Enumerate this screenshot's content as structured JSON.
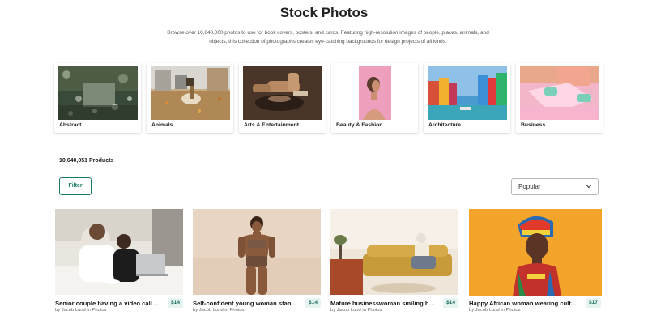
{
  "header": {
    "title": "Stock Photos",
    "description": "Browse over 10,640,000 photos to use for book covers, posters, and cards. Featuring high-resolution images of people, places, animals, and objects, this collection of photographs creates eye-catching backgrounds for design projects of all kinds."
  },
  "categories": [
    {
      "label": "Abstract",
      "icon": "rain-bokeh-photo"
    },
    {
      "label": "Animals",
      "icon": "dog-autumn-photo"
    },
    {
      "label": "Arts & Entertainment",
      "icon": "pottery-hands-photo"
    },
    {
      "label": "Beauty & Fashion",
      "icon": "woman-pink-photo"
    },
    {
      "label": "Architecture",
      "icon": "colorful-canal-houses-photo"
    },
    {
      "label": "Business",
      "icon": "pink-desk-hands-photo"
    }
  ],
  "listing": {
    "count_text": "10,640,051 Products",
    "filter_label": "Filter",
    "sort_value": "Popular"
  },
  "products": [
    {
      "title": "Senior couple having a video call ...",
      "price": "$14",
      "author": "Jacob Lund",
      "in_text": "in",
      "collection": "Photos"
    },
    {
      "title": "Self-confident young woman stan...",
      "price": "$14",
      "author": "Jacob Lund",
      "in_text": "in",
      "collection": "Photos"
    },
    {
      "title": "Mature businesswoman smiling ha...",
      "price": "$14",
      "author": "Jacob Lund",
      "in_text": "in",
      "collection": "Photos"
    },
    {
      "title": "Happy African woman wearing cult...",
      "price": "$17",
      "author": "Jacob Lund",
      "in_text": "in",
      "collection": "Photos"
    }
  ],
  "meta_prefix": "by",
  "colors": {
    "accent": "#1a7a6a",
    "price_bg": "#e6f4f1",
    "price_text": "#1a6a5e"
  }
}
